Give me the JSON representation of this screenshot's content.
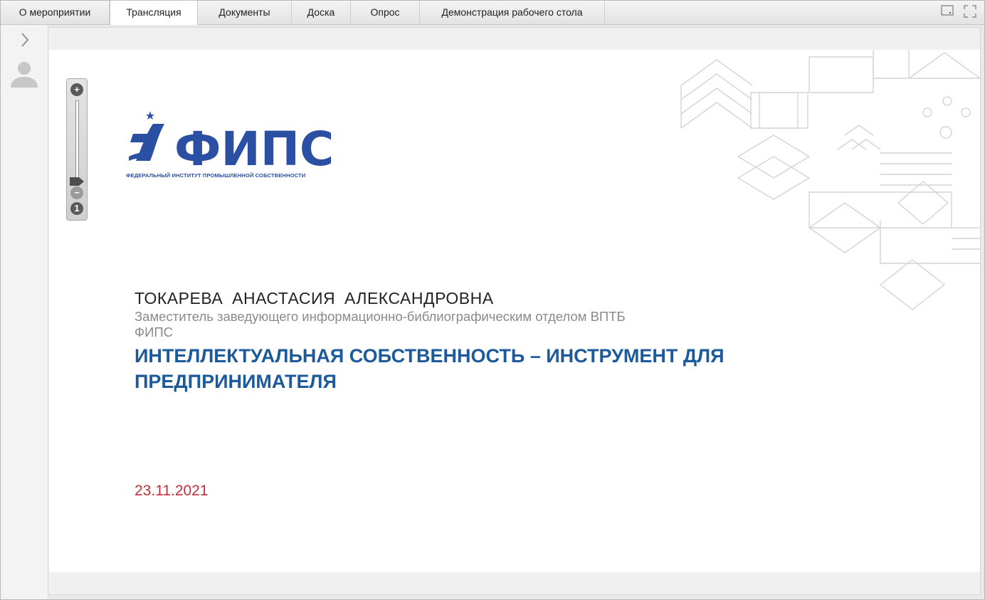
{
  "tabs": [
    {
      "label": "О мероприятии",
      "active": false
    },
    {
      "label": "Трансляция",
      "active": true
    },
    {
      "label": "Документы",
      "active": false
    },
    {
      "label": "Доска",
      "active": false
    },
    {
      "label": "Опрос",
      "active": false
    },
    {
      "label": "Демонстрация рабочего стола",
      "active": false
    }
  ],
  "window_controls": {
    "restore_icon": "window-restore-icon",
    "fullscreen_icon": "fullscreen-icon"
  },
  "sidebar": {
    "toggle_icon": "chevron-right-icon",
    "avatar_icon": "user-icon"
  },
  "zoom_control": {
    "zoom_in_label": "+",
    "zoom_out_label": "−",
    "reset_label": "1",
    "level": 0.0
  },
  "slide": {
    "logo": {
      "text": "ФИПС",
      "caption": "ФЕДЕРАЛЬНЫЙ ИНСТИТУТ ПРОМЫШЛЕННОЙ СОБСТВЕННОСТИ",
      "color": "#2a4fa3"
    },
    "speaker_name": "ТОКАРЕВА  АНАСТАСИЯ  АЛЕКСАНДРОВНА",
    "speaker_role": "Заместитель заведующего информационно-библиографическим отделом ВПТБ ФИПС",
    "title": "ИНТЕЛЛЕКТУАЛЬНАЯ СОБСТВЕННОСТЬ – ИНСТРУМЕНТ ДЛЯ ПРЕДПРИНИМАТЕЛЯ",
    "date": "23.11.2021",
    "colors": {
      "title": "#1d5a9c",
      "date": "#c0303b",
      "role": "#8a8a8a"
    }
  }
}
